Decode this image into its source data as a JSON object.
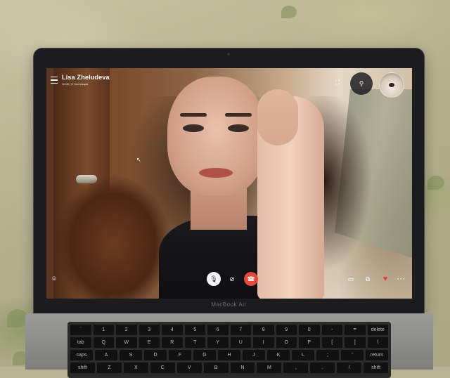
{
  "call": {
    "caller_name": "Lisa Zheludeva",
    "duration": "11:08",
    "meta_label": "Коллекция"
  },
  "laptop": {
    "brand": "MacBook Air"
  },
  "icons": {
    "menu": "menu-icon",
    "fit": "fit-screen-icon",
    "add_person": "add-person-icon",
    "self_view": "self-view-avatar",
    "screenshot": "screenshot-icon",
    "mic": "microphone-icon",
    "camera_off": "camera-off-icon",
    "end_call": "end-call-icon",
    "chat": "chat-icon",
    "share_screen": "share-screen-icon",
    "react": "heart-icon",
    "more": "more-icon"
  },
  "colors": {
    "end_call": "#e24a3b",
    "heart": "#e23a3a",
    "bezel": "#1c1c1e"
  },
  "keyboard": {
    "rows": [
      [
        "`",
        "1",
        "2",
        "3",
        "4",
        "5",
        "6",
        "7",
        "8",
        "9",
        "0",
        "-",
        "=",
        "delete"
      ],
      [
        "tab",
        "Q",
        "W",
        "E",
        "R",
        "T",
        "Y",
        "U",
        "I",
        "O",
        "P",
        "[",
        "]",
        "\\"
      ],
      [
        "caps",
        "A",
        "S",
        "D",
        "F",
        "G",
        "H",
        "J",
        "K",
        "L",
        ";",
        "'",
        "return"
      ],
      [
        "shift",
        "Z",
        "X",
        "C",
        "V",
        "B",
        "N",
        "M",
        ",",
        ".",
        "/",
        "shift"
      ]
    ]
  }
}
